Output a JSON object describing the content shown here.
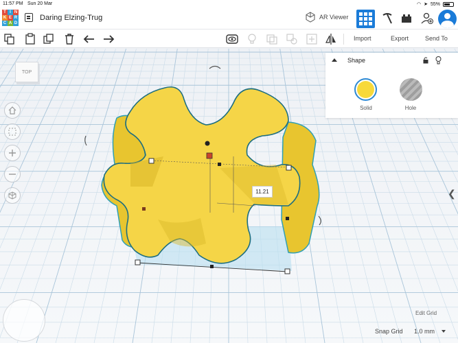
{
  "status_bar": {
    "time": "11:57 PM",
    "date": "Sun 20 Mar",
    "battery": "55%"
  },
  "header": {
    "logo_letters": [
      "T",
      "I",
      "N",
      "K",
      "E",
      "R",
      "C",
      "A",
      "D"
    ],
    "design_title": "Daring Elzing-Trug",
    "ar_viewer_label": "AR Viewer"
  },
  "toolbar": {
    "import_label": "Import",
    "export_label": "Export",
    "send_to_label": "Send To"
  },
  "viewcube": {
    "face_label": "TOP"
  },
  "shape_panel": {
    "title": "Shape",
    "solid_label": "Solid",
    "hole_label": "Hole",
    "solid_color": "#f7d93a"
  },
  "dimension_label": "11.21",
  "workplane": {
    "edit_grid_label": "Edit Grid",
    "snap_grid_label": "Snap Grid",
    "snap_grid_value": "1.0 mm"
  },
  "colors": {
    "accent": "#1a7bd8",
    "shape_fill": "#f5d547",
    "selection_outline": "#3fb2c8"
  }
}
